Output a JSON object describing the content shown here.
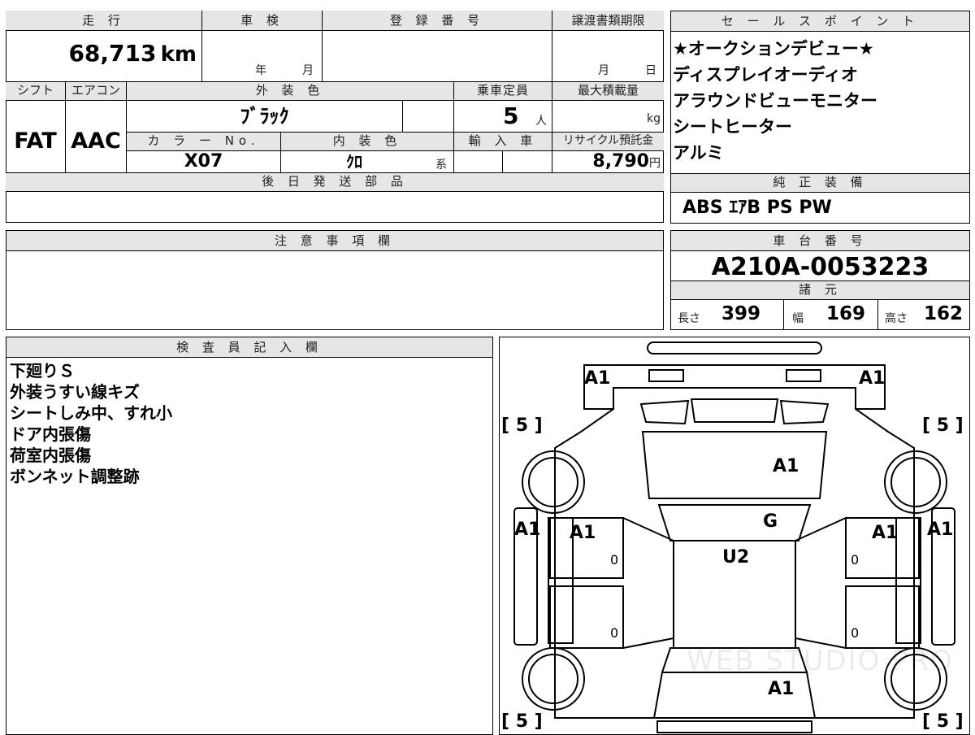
{
  "top_table": {
    "mileage_label": "走 行",
    "mileage_value": "68,713",
    "mileage_unit": "km",
    "inspection_label": "車 検",
    "inspection_year": "年",
    "inspection_month": "月",
    "registration_label": "登 録 番 号",
    "transfer_label": "譲渡書類期限",
    "transfer_month": "月",
    "transfer_day": "日",
    "shift_label": "シフト",
    "shift_value": "FAT",
    "aircon_label": "エアコン",
    "aircon_value": "AAC",
    "exterior_label": "外 装 色",
    "exterior_value": "ﾌﾞﾗｯｸ",
    "capacity_label": "乗車定員",
    "capacity_value": "5",
    "capacity_unit": "人",
    "load_label": "最大積載量",
    "load_unit": "kg",
    "color_no_label": "カ ラ ー No.",
    "color_no_value": "X07",
    "interior_label": "内 装 色",
    "interior_value": "ｸﾛ",
    "interior_unit": "系",
    "import_label": "輸 入 車",
    "recycle_label": "リサイクル預託金",
    "recycle_value": "8,790",
    "recycle_unit": "円",
    "later_parts_label": "後 日 発 送 部 品"
  },
  "sales_points": {
    "label": "セ ー ル ス ポ イ ン ト",
    "lines": [
      "★オークションデビュー★",
      "ディスプレイオーディオ",
      "アラウンドビューモニター",
      "シートヒーター",
      "アルミ"
    ]
  },
  "equipment": {
    "label": "純 正 装 備",
    "value": "ABS ｴｱB PS PW"
  },
  "notes": {
    "label": "注 意 事 項 欄"
  },
  "chassis": {
    "label": "車 台 番 号",
    "value": "A210A-0053223",
    "specs_label": "諸 元",
    "length_label": "長さ",
    "length_value": "399",
    "width_label": "幅",
    "width_value": "169",
    "height_label": "高さ",
    "height_value": "162"
  },
  "inspector": {
    "label": "検 査 員 記 入 欄",
    "lines": [
      "下廻りＳ",
      "外装うすい線キズ",
      "シートしみ中、すれ小",
      "ドア内張傷",
      "荷室内張傷",
      "ボンネット調整跡"
    ]
  },
  "diagram": {
    "marks": {
      "front_left": "A1",
      "front_right": "A1",
      "bonnet": "A1",
      "windshield": "G",
      "roof": "U2",
      "left_side": "A1",
      "right_side": "A1",
      "left_front_door": "A1",
      "right_front_door": "A1",
      "rear": "A1",
      "door_zero": "0",
      "tire_bracket": "[ 5 ]"
    },
    "watermark": "WEB STUDIO PRO"
  }
}
